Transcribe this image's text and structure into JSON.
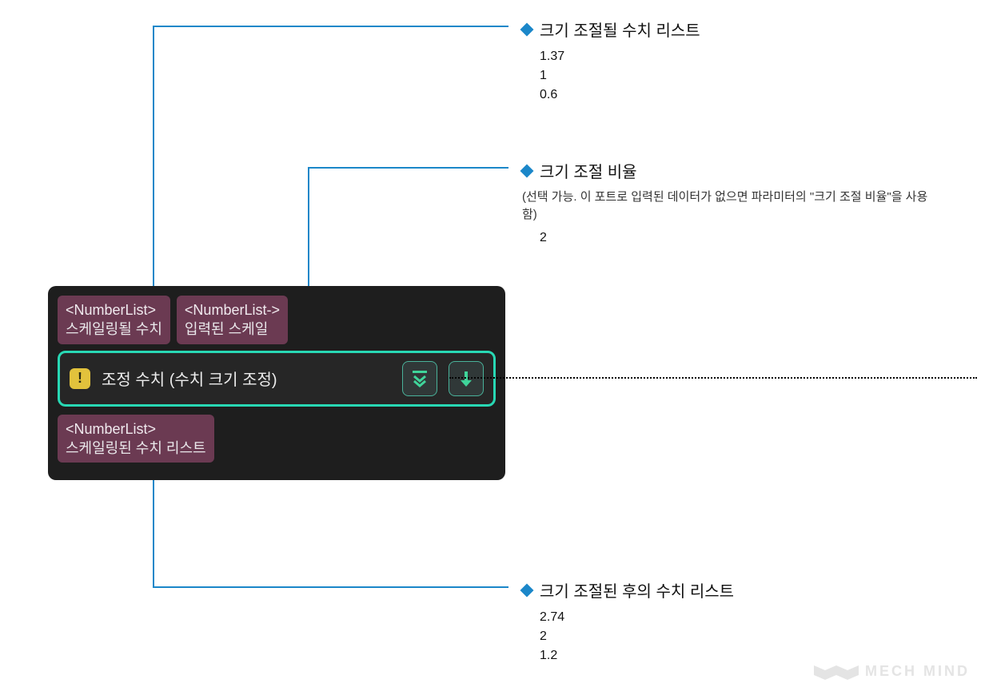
{
  "node": {
    "inputs": [
      {
        "type": "<NumberList>",
        "label": "스케일링될 수치"
      },
      {
        "type": "<NumberList->",
        "label": "입력된 스케일"
      }
    ],
    "title": "조정 수치 (수치 크기 조정)",
    "output": {
      "type": "<NumberList>",
      "label": "스케일링된 수치 리스트"
    }
  },
  "annotations": {
    "input_list": {
      "title": "크기 조절될 수치 리스트",
      "values": "1.37\n1\n0.6"
    },
    "scale": {
      "title": "크기 조절 비율",
      "subtitle": "(선택 가능. 이 포트로 입력된 데이터가 없으면 파라미터의 \"크기 조절 비율\"을 사용함)",
      "values": "2"
    },
    "output_list": {
      "title": "크기 조절된 후의 수치 리스트",
      "values": "2.74\n2\n1.2"
    }
  },
  "watermark": "MECH MIND"
}
